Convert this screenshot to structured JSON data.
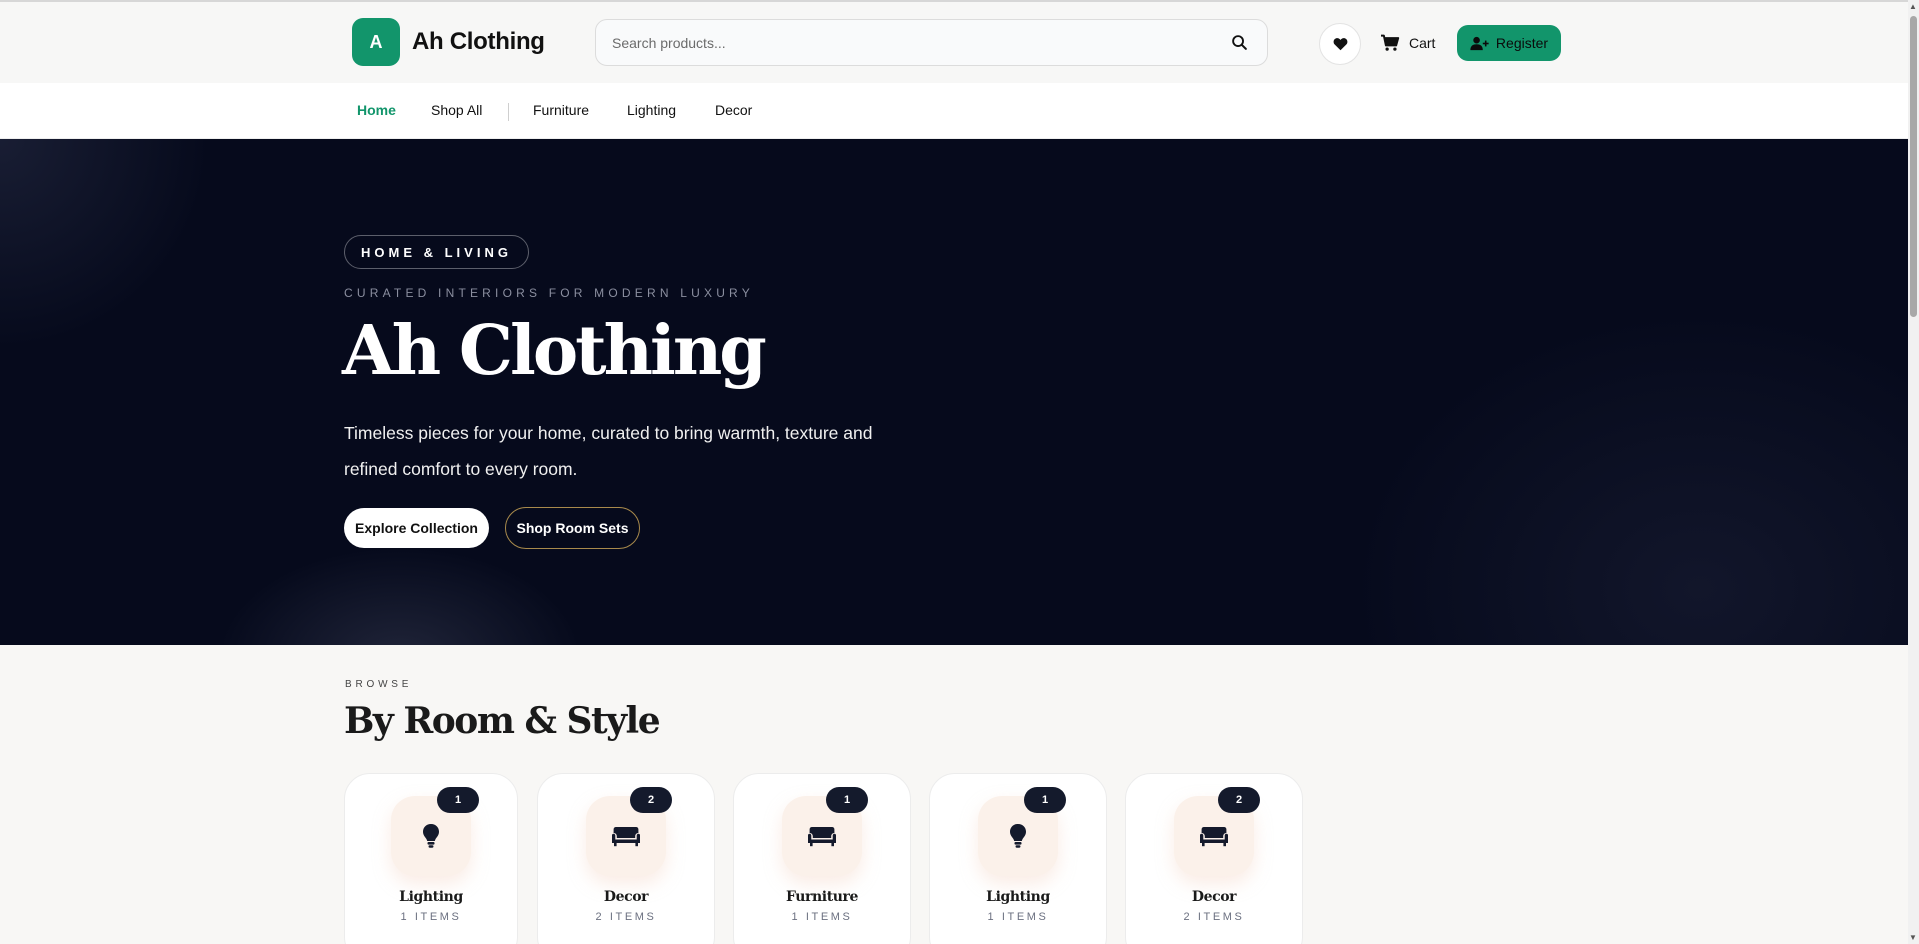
{
  "brand": {
    "logo_letter": "A",
    "name": "Ah Clothing"
  },
  "search": {
    "placeholder": "Search products..."
  },
  "header": {
    "cart_label": "Cart",
    "register_label": "Register"
  },
  "nav": {
    "items": [
      {
        "label": "Home",
        "active": true
      },
      {
        "label": "Shop All"
      },
      {
        "label": "Furniture"
      },
      {
        "label": "Lighting"
      },
      {
        "label": "Decor"
      }
    ]
  },
  "hero": {
    "badge": "HOME & LIVING",
    "kicker": "CURATED INTERIORS FOR MODERN LUXURY",
    "title": "Ah Clothing",
    "description": "Timeless pieces for your home, curated to bring warmth, texture and refined comfort to every room.",
    "primary_cta": "Explore Collection",
    "secondary_cta": "Shop Room Sets"
  },
  "browse": {
    "kicker": "BROWSE",
    "title": "By Room & Style",
    "categories": [
      {
        "name": "Lighting",
        "count": "1",
        "items": "1 ITEMS",
        "icon": "lightbulb-icon"
      },
      {
        "name": "Decor",
        "count": "2",
        "items": "2 ITEMS",
        "icon": "couch-icon"
      },
      {
        "name": "Furniture",
        "count": "1",
        "items": "1 ITEMS",
        "icon": "couch-icon"
      },
      {
        "name": "Lighting",
        "count": "1",
        "items": "1 ITEMS",
        "icon": "lightbulb-icon"
      },
      {
        "name": "Decor",
        "count": "2",
        "items": "2 ITEMS",
        "icon": "couch-icon"
      }
    ]
  },
  "colors": {
    "accent": "#12956b",
    "hero_bg": "#060a1c",
    "badge_bg": "#141a2c",
    "card_icon_bg": "#fbf1ea"
  }
}
